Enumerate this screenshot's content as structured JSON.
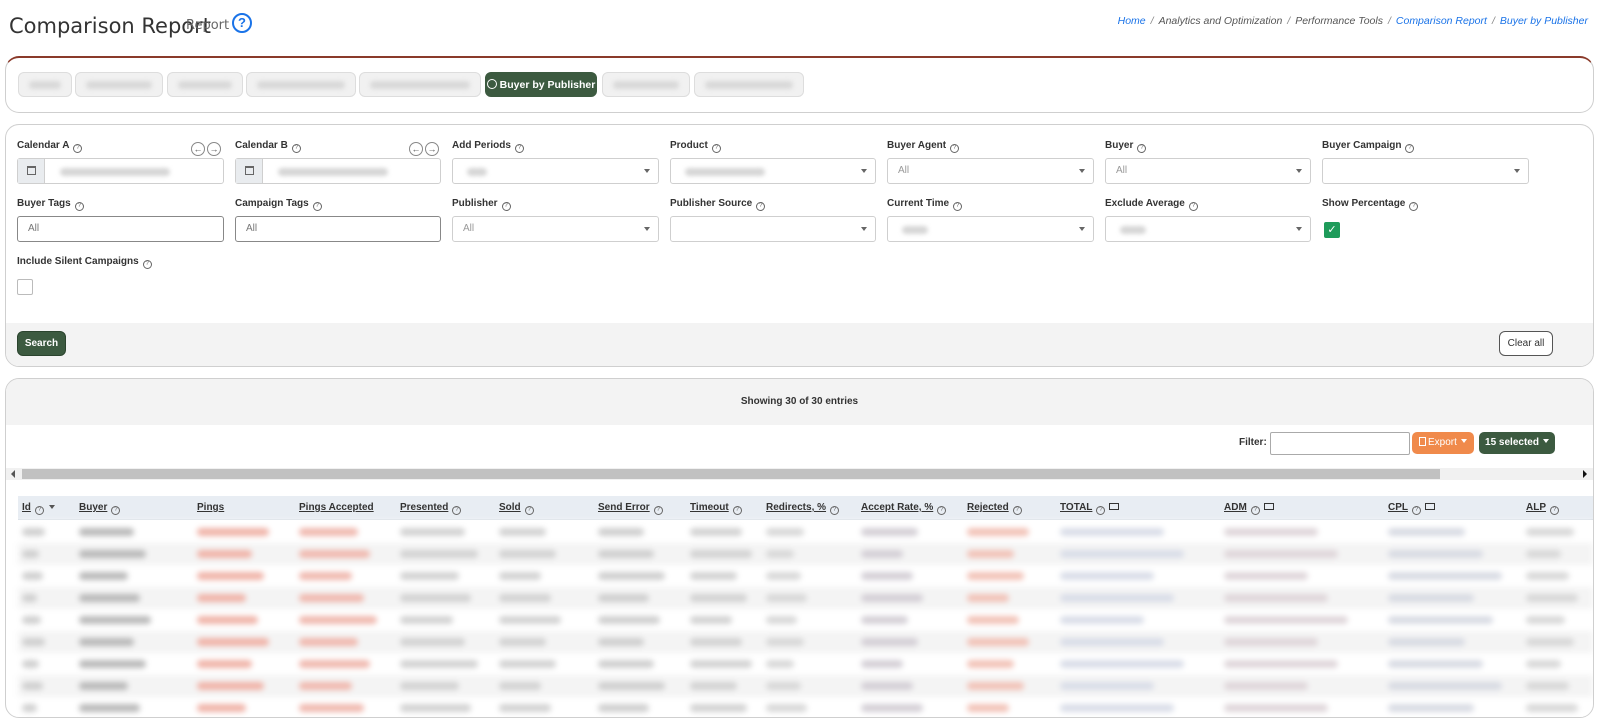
{
  "header": {
    "title": "Comparison Report",
    "subtitle": "Report",
    "help_icon": "question-circle-icon",
    "breadcrumb": [
      "Home",
      "Analytics and Optimization",
      "Performance Tools",
      "Comparison Report",
      "Buyer by Publisher"
    ]
  },
  "tabs": {
    "active_label": "Buyer by Publisher",
    "active_icon": "user-circle-icon"
  },
  "filters": {
    "calendar_a": "Calendar A",
    "calendar_b": "Calendar B",
    "add_periods": "Add Periods",
    "product": "Product",
    "buyer_agent": "Buyer Agent",
    "buyer_agent_value": "All",
    "buyer": "Buyer",
    "buyer_value": "All",
    "buyer_campaign": "Buyer Campaign",
    "buyer_tags": "Buyer Tags",
    "buyer_tags_value": "All",
    "campaign_tags": "Campaign Tags",
    "campaign_tags_value": "All",
    "publisher": "Publisher",
    "publisher_value": "All",
    "publisher_source": "Publisher Source",
    "current_time": "Current Time",
    "exclude_average": "Exclude Average",
    "show_percentage": "Show Percentage",
    "include_silent": "Include Silent Campaigns",
    "search_label": "Search",
    "clear_label": "Clear all"
  },
  "table": {
    "showing": "Showing 30 of 30 entries",
    "filter_label": "Filter:",
    "export_label": "Export",
    "selected_label": "15 selected",
    "columns": [
      "Id",
      "Buyer",
      "Pings",
      "Pings Accepted",
      "Presented",
      "Sold",
      "Send Error",
      "Timeout",
      "Redirects, %",
      "Accept Rate, %",
      "Rejected",
      "TOTAL",
      "ADM",
      "CPL",
      "ALP"
    ]
  },
  "colors": {
    "accent_green": "#3c5a40",
    "export_orange": "#f08a4b",
    "check_green": "#1e9b5a",
    "link_blue": "#1a73e8"
  }
}
